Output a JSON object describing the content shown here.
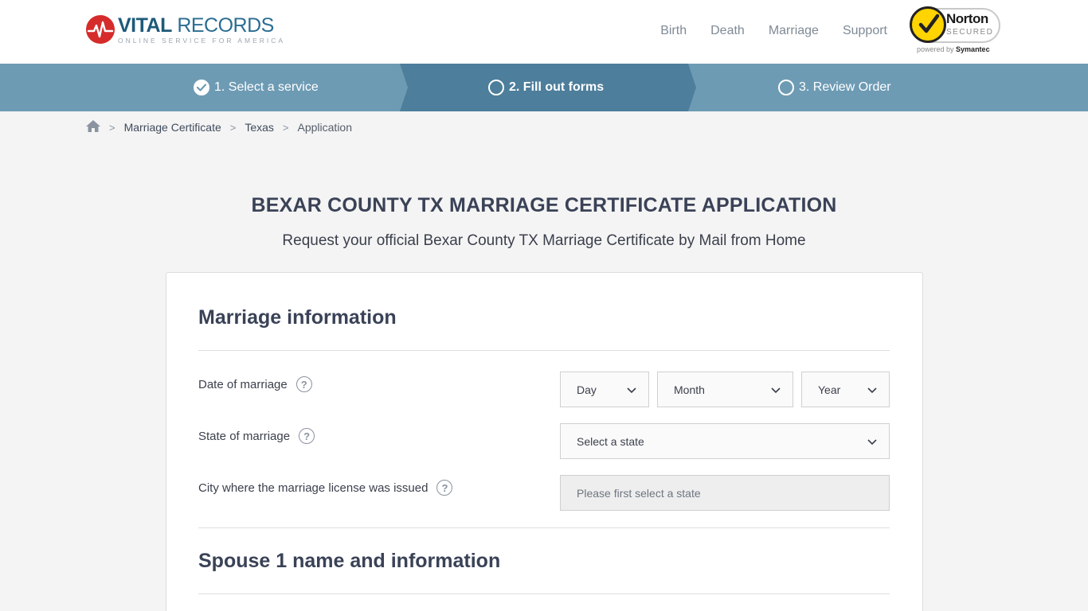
{
  "header": {
    "logo": {
      "title_bold": "VITAL",
      "title_light": "RECORDS",
      "subtitle": "ONLINE SERVICE FOR AMERICA"
    },
    "nav": [
      {
        "label": "Birth"
      },
      {
        "label": "Death"
      },
      {
        "label": "Marriage"
      },
      {
        "label": "Support"
      }
    ],
    "norton": {
      "name": "Norton",
      "secured": "SECURED",
      "powered_by": "powered by",
      "symantec": "Symantec"
    }
  },
  "steps": [
    {
      "label": "1. Select a service",
      "state": "done"
    },
    {
      "label": "2. Fill out forms",
      "state": "active"
    },
    {
      "label": "3. Review Order",
      "state": "pending"
    }
  ],
  "breadcrumb": {
    "items": [
      "Marriage Certificate",
      "Texas"
    ],
    "current": "Application"
  },
  "page": {
    "title": "BEXAR COUNTY TX MARRIAGE CERTIFICATE APPLICATION",
    "subtitle": "Request your official Bexar County TX Marriage Certificate by Mail from Home"
  },
  "form": {
    "marriage_section": {
      "title": "Marriage information",
      "date_label": "Date of marriage",
      "day": "Day",
      "month": "Month",
      "year": "Year",
      "state_label": "State of marriage",
      "state_select": "Select a state",
      "city_label": "City where the marriage license was issued",
      "city_placeholder": "Please first select a state"
    },
    "spouse1_section": {
      "title": "Spouse 1 name and information"
    }
  },
  "colors": {
    "steps_bar": "#6e9bb4",
    "steps_active": "#4d7e9b",
    "logo_red": "#d62b2b",
    "logo_blue": "#1d5a7a",
    "norton_yellow": "#ffd400"
  }
}
